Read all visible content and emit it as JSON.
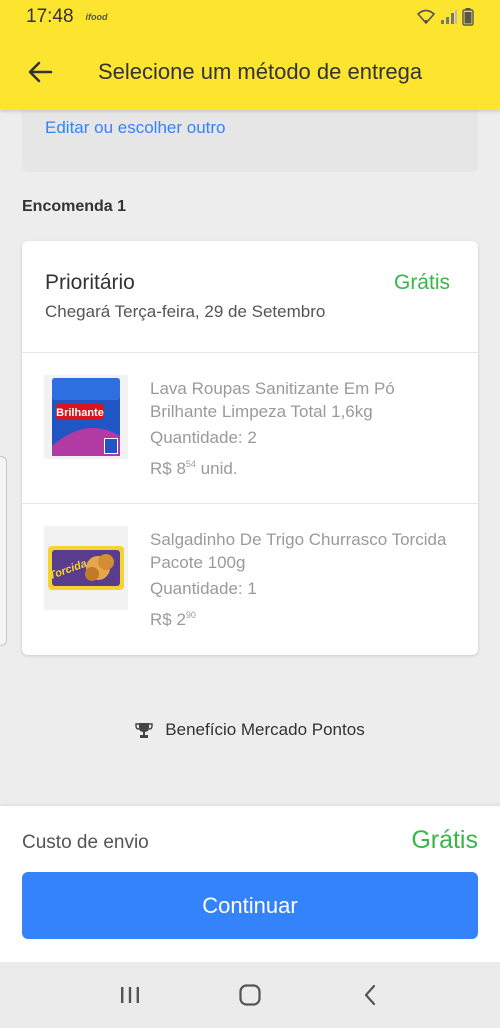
{
  "status_bar": {
    "time": "17:48",
    "app_indicator": "ifood"
  },
  "app_bar": {
    "title": "Selecione um método de entrega"
  },
  "address": {
    "edit_link": "Editar ou escolher outro"
  },
  "order": {
    "title": "Encomenda 1",
    "method": {
      "name": "Prioritário",
      "price": "Grátis",
      "delivery_date": "Chegará Terça-feira, 29 de Setembro"
    },
    "items": [
      {
        "title": "Lava Roupas Sanitizante Em Pó Brilhante Limpeza Total 1,6kg",
        "quantity": "Quantidade: 2",
        "price_currency": "R$ 8",
        "price_cents": "54",
        "price_unit": " unid.",
        "image_label": "Brilhante",
        "image_badge": "1,6 kg"
      },
      {
        "title": "Salgadinho De Trigo Churrasco Torcida Pacote 100g",
        "quantity": "Quantidade: 1",
        "price_currency": "R$ 2",
        "price_cents": "90",
        "price_unit": "",
        "image_label": "Torcida"
      }
    ]
  },
  "benefit": {
    "label": "Benefício Mercado Pontos",
    "icon": "trophy-icon"
  },
  "footer": {
    "shipping_label": "Custo de envio",
    "shipping_value": "Grátis",
    "continue_label": "Continuar"
  },
  "colors": {
    "brand_yellow": "#fde52f",
    "primary_blue": "#3483fa",
    "free_green": "#39b54a"
  }
}
